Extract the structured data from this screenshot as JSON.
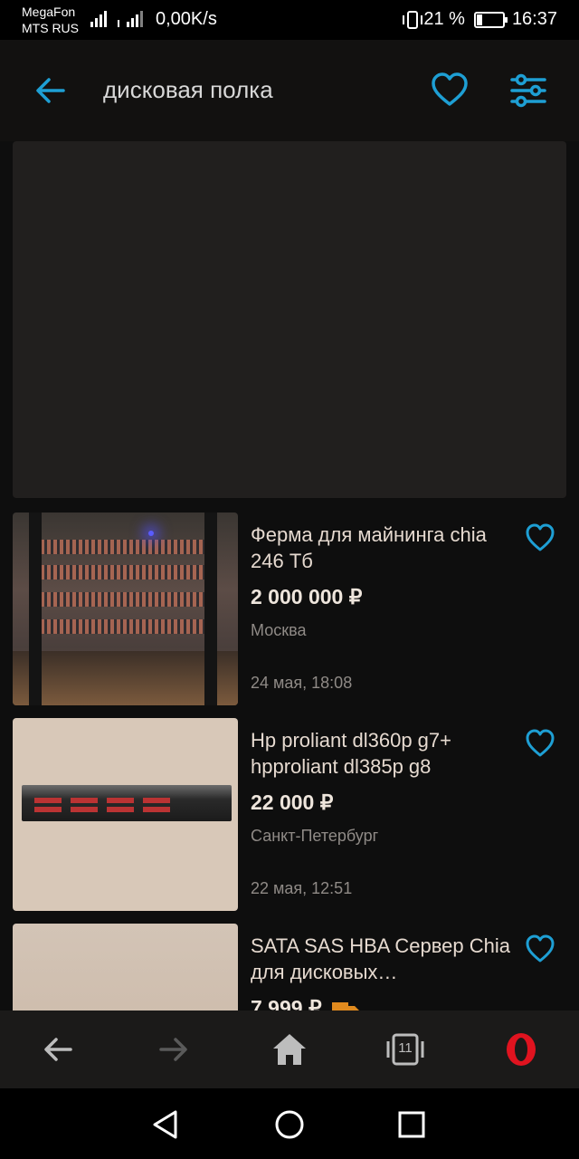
{
  "status_bar": {
    "carrier1": "MegaFon",
    "carrier2": "MTS RUS",
    "net_speed": "0,00K/s",
    "battery_percent": "21 %",
    "battery_level": 0.21,
    "time": "16:37"
  },
  "header": {
    "search_query": "дисковая полка",
    "back_icon": "arrow-left-icon",
    "favorite_icon": "heart-outline-icon",
    "filter_icon": "sliders-icon",
    "accent_color": "#1e9fd4"
  },
  "listings": [
    {
      "title": "Ферма для майнинга chia 246 Тб",
      "price": "2 000 000 ₽",
      "city": "Москва",
      "date": "24 мая, 18:08"
    },
    {
      "title": "Hp proliant dl360p g7+ hpproliant dl385p g8",
      "price": "22 000 ₽",
      "city": "Санкт-Петербург",
      "date": "22 мая, 12:51"
    },
    {
      "title": "SATA SAS HBA Сервер Chia для дисковых…",
      "price": "7 999 ₽",
      "delivery_icon": "truck-icon"
    }
  ],
  "browser_bar": {
    "back_icon": "arrow-left-icon",
    "forward_icon": "arrow-right-icon",
    "home_icon": "home-icon",
    "tabs_count": "11",
    "opera_icon": "opera-logo-icon"
  },
  "android_nav": {
    "back_icon": "triangle-back-icon",
    "home_icon": "circle-home-icon",
    "recents_icon": "square-recents-icon"
  }
}
